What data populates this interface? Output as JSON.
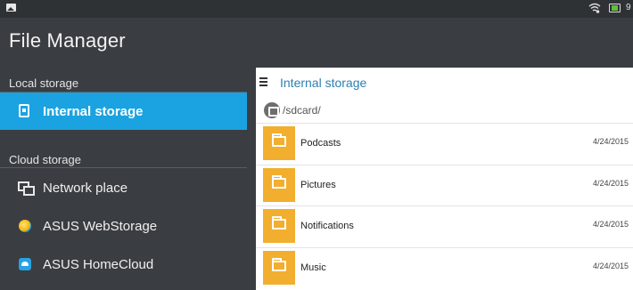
{
  "status_bar": {
    "gallery_icon": "gallery-icon",
    "wifi_icon": "wifi-icon",
    "battery_icon": "battery-charging-icon",
    "time_partial": "9"
  },
  "app": {
    "title": "File Manager"
  },
  "drawer": {
    "local_section_label": "Local storage",
    "cloud_section_label": "Cloud storage",
    "items": [
      {
        "label": "Internal storage",
        "icon": "internal-storage-icon",
        "active": true
      },
      {
        "label": "Network place",
        "icon": "network-place-icon",
        "active": false
      },
      {
        "label": "ASUS WebStorage",
        "icon": "asus-webstorage-icon",
        "active": false
      },
      {
        "label": "ASUS HomeCloud",
        "icon": "asus-homecloud-icon",
        "active": false
      }
    ]
  },
  "main": {
    "toolbar_title": "Internal storage",
    "path": "/sdcard/",
    "files": [
      {
        "name": "Podcasts",
        "date": "4/24/2015",
        "icon": "folder-icon"
      },
      {
        "name": "Pictures",
        "date": "4/24/2015",
        "icon": "folder-icon"
      },
      {
        "name": "Notifications",
        "date": "4/24/2015",
        "icon": "folder-icon"
      },
      {
        "name": "Music",
        "date": "4/24/2015",
        "icon": "folder-icon"
      }
    ]
  },
  "colors": {
    "accent": "#1aa3e0",
    "folder": "#f2ae2e",
    "background": "#3a3d41",
    "toolbar_title": "#2d7fb0"
  }
}
